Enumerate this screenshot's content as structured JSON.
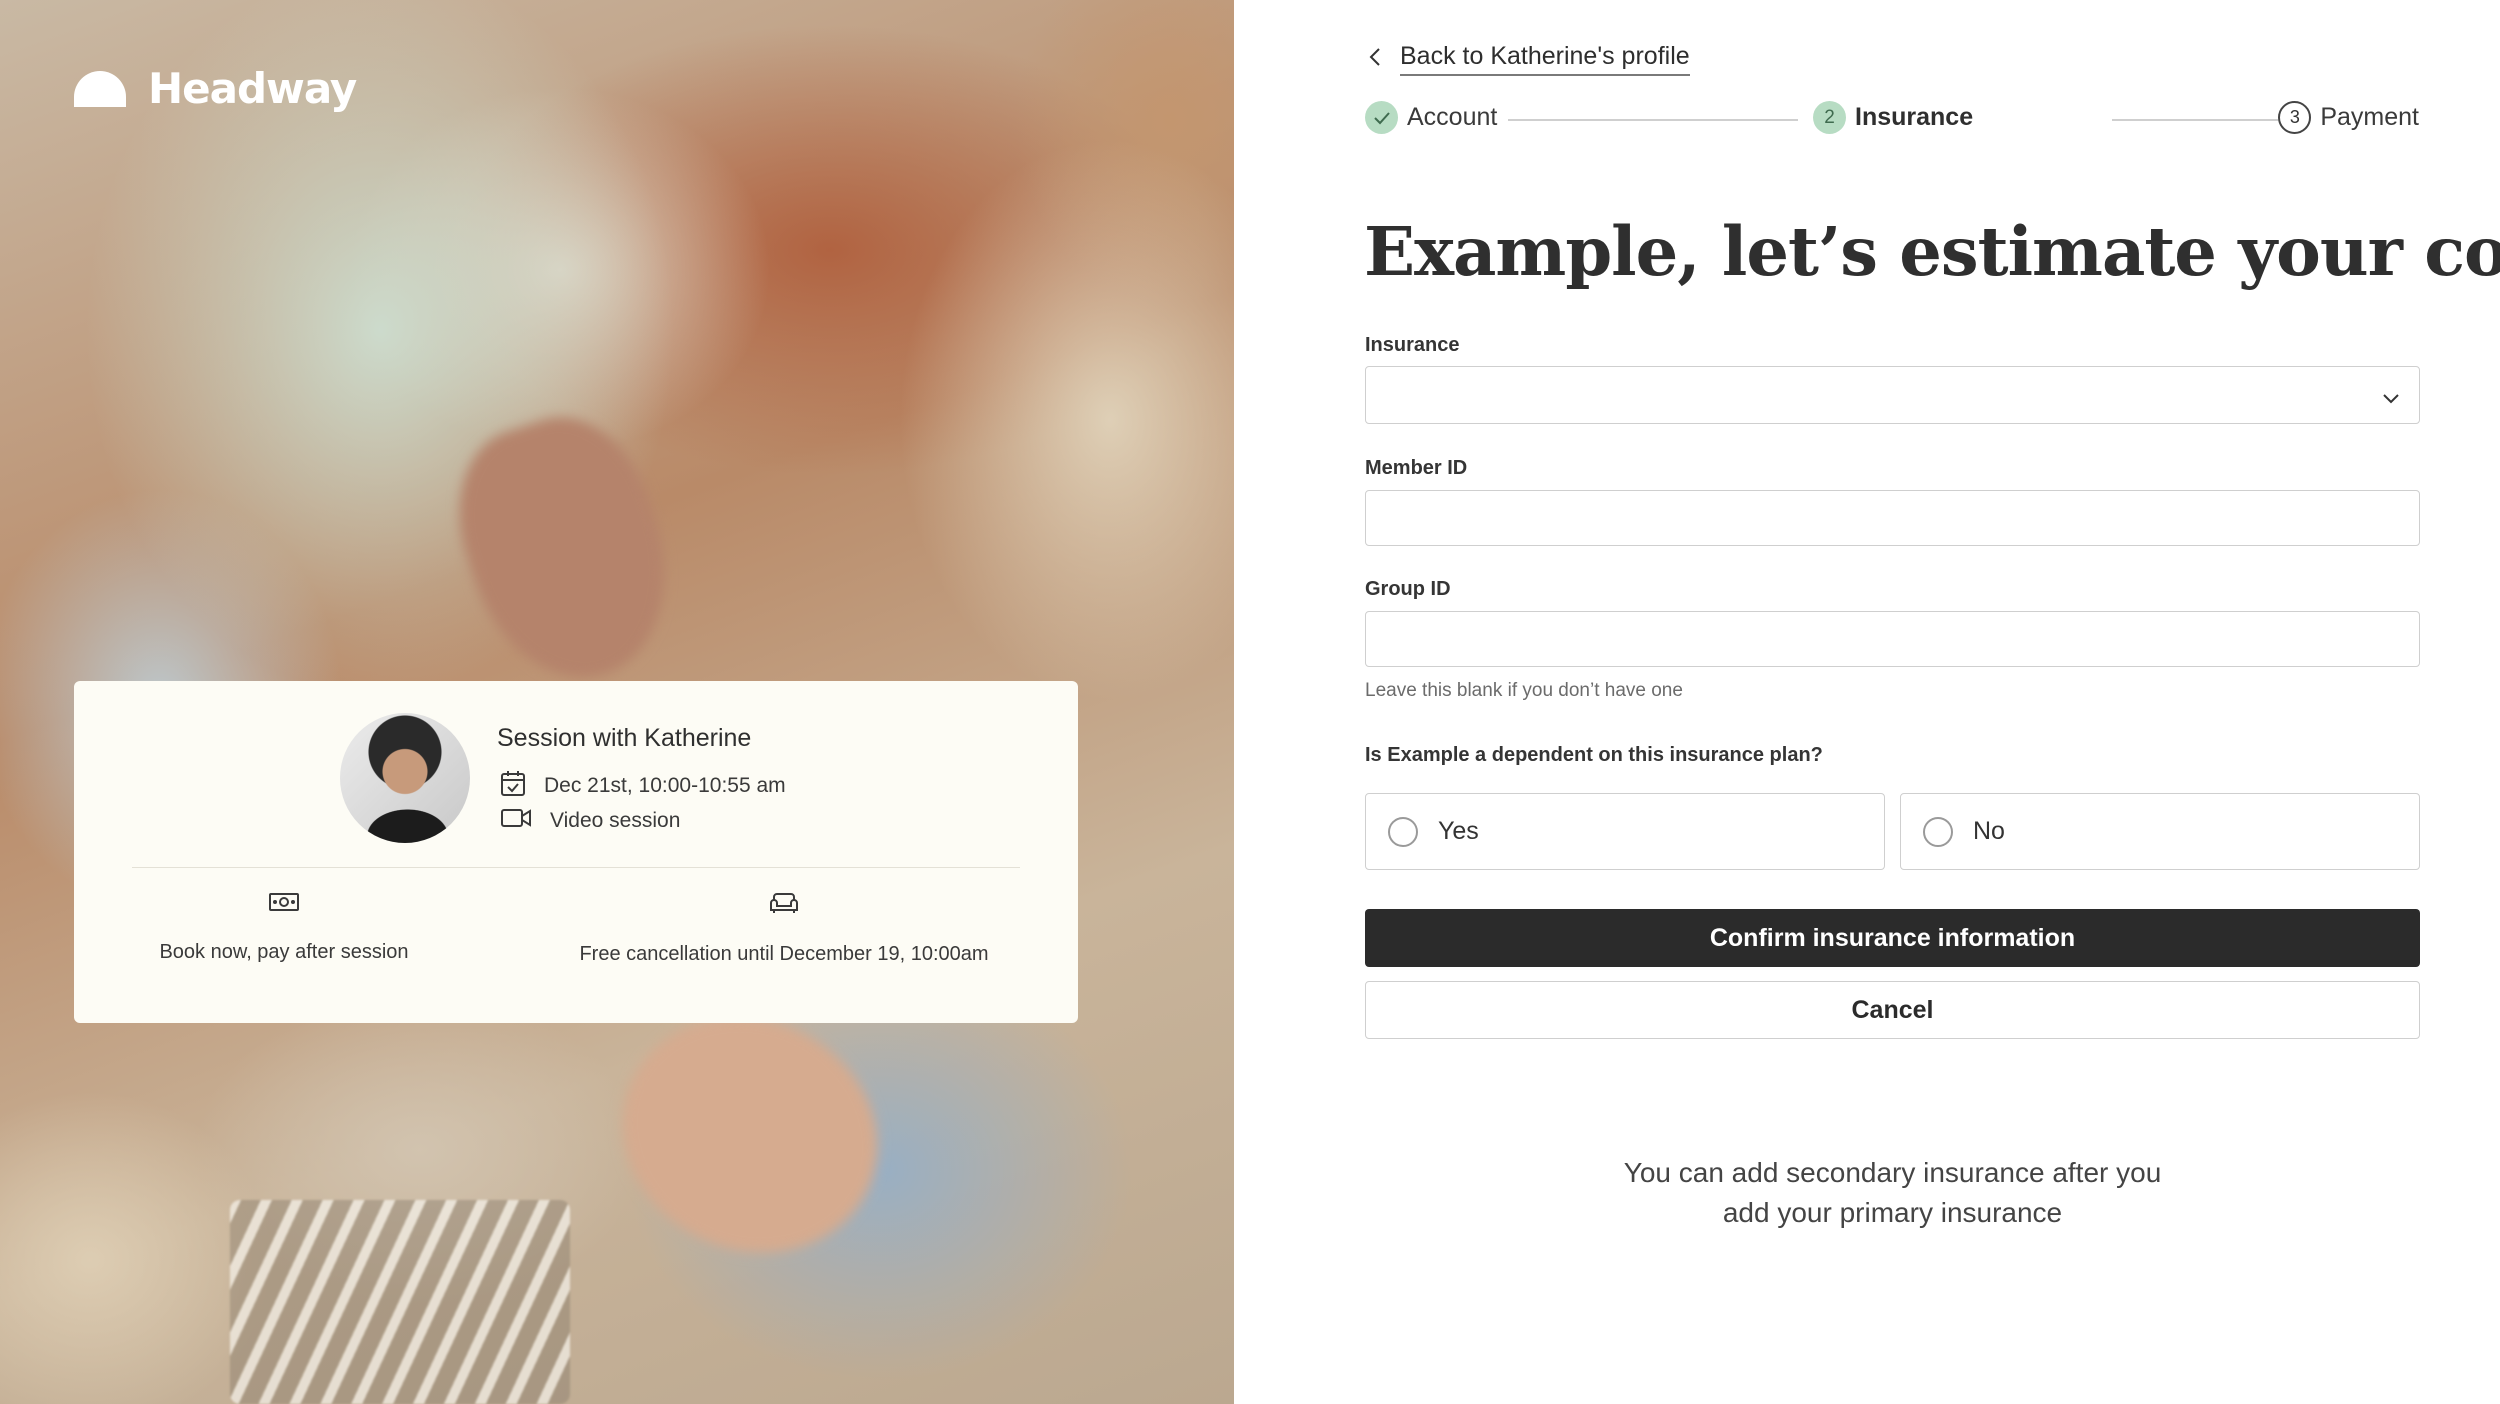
{
  "brand": {
    "name": "Headway",
    "accent": "#b7dcc3",
    "dark": "#2b2b2b"
  },
  "session_card": {
    "title": "Session with Katherine",
    "date": "Dec 21st, 10:00-10:55 am",
    "type": "Video session",
    "perks": [
      {
        "icon": "money-icon",
        "label": "Book now, pay after session"
      },
      {
        "icon": "couch-icon",
        "label": "Free cancellation until December 19, 10:00am"
      }
    ]
  },
  "nav": {
    "back_label": "Back to Katherine's profile"
  },
  "stepper": {
    "steps": [
      {
        "label": "Account",
        "state": "complete"
      },
      {
        "label": "Insurance",
        "number": "2",
        "state": "current"
      },
      {
        "label": "Payment",
        "number": "3",
        "state": "upcoming"
      }
    ]
  },
  "form": {
    "heading": "Example, let’s estimate your cost",
    "insurance": {
      "label": "Insurance",
      "value": ""
    },
    "member_id": {
      "label": "Member ID",
      "value": ""
    },
    "group_id": {
      "label": "Group ID",
      "value": "",
      "helper": "Leave this blank if you don’t have one"
    },
    "dependent": {
      "question": "Is Example a dependent on this insurance plan?",
      "options": [
        "Yes",
        "No"
      ],
      "selected": null
    },
    "confirm_label": "Confirm insurance information",
    "cancel_label": "Cancel",
    "note_line1": "You can add secondary insurance after you",
    "note_line2": "add your primary insurance"
  }
}
